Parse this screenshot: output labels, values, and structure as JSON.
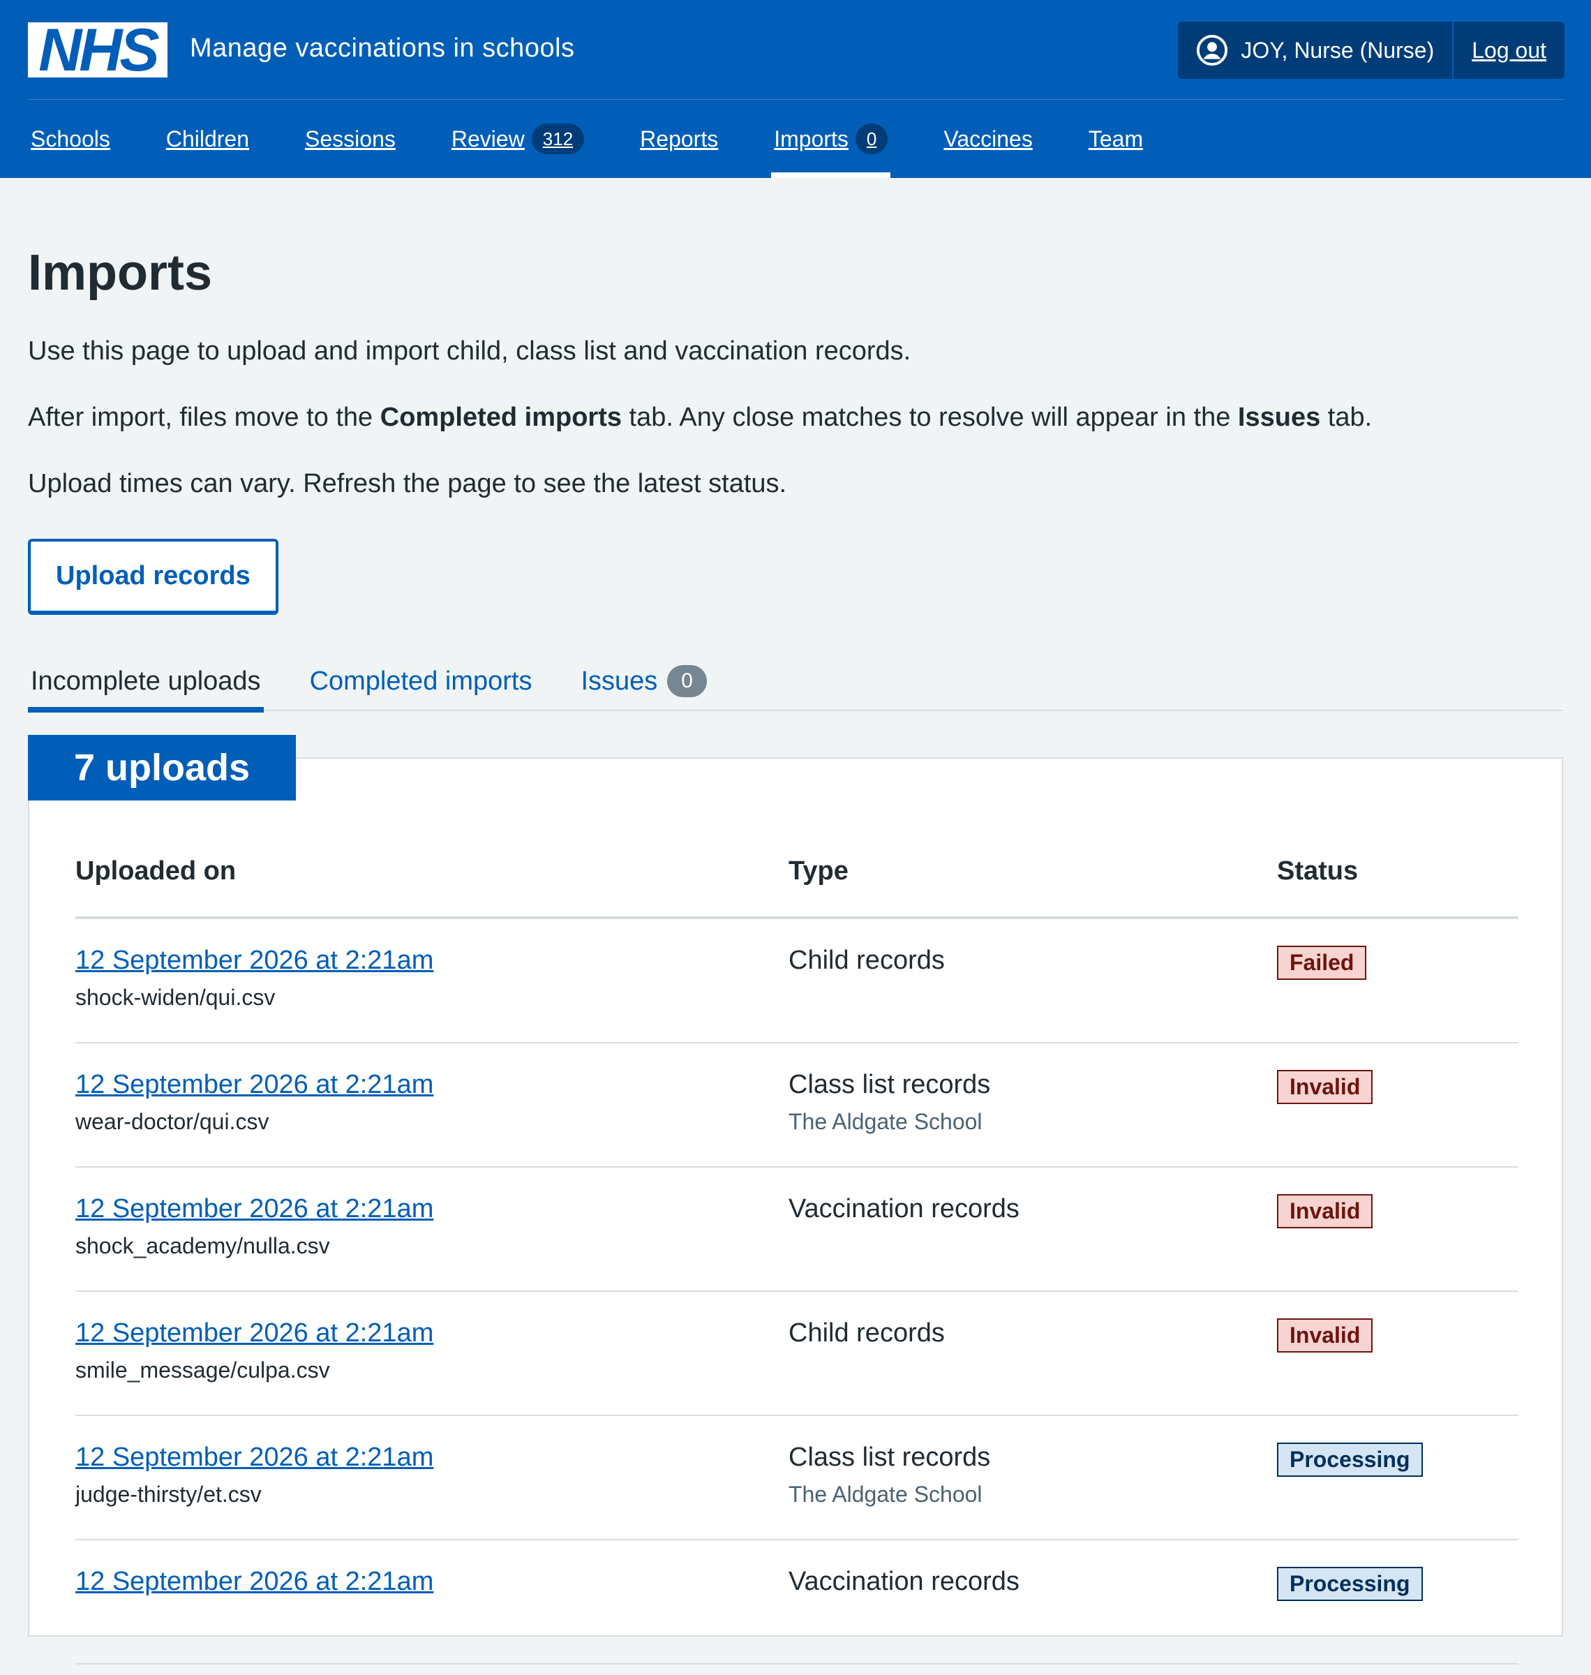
{
  "header": {
    "logo": "NHS",
    "service_name": "Manage vaccinations in schools",
    "user": "JOY, Nurse (Nurse)",
    "logout": "Log out",
    "nav": [
      {
        "label": "Schools"
      },
      {
        "label": "Children"
      },
      {
        "label": "Sessions"
      },
      {
        "label": "Review",
        "count": "312"
      },
      {
        "label": "Reports"
      },
      {
        "label": "Imports",
        "count": "0",
        "active": true
      },
      {
        "label": "Vaccines"
      },
      {
        "label": "Team"
      }
    ]
  },
  "page": {
    "title": "Imports",
    "intro1": "Use this page to upload and import child, class list and vaccination records.",
    "intro2_a": "After import, files move to the ",
    "intro2_b": "Completed imports",
    "intro2_c": " tab. Any close matches to resolve will appear in the ",
    "intro2_d": "Issues",
    "intro2_e": " tab.",
    "intro3": "Upload times can vary. Refresh the page to see the latest status.",
    "upload_button": "Upload records"
  },
  "tabs": [
    {
      "label": "Incomplete uploads",
      "active": true
    },
    {
      "label": "Completed imports"
    },
    {
      "label": "Issues",
      "count": "0"
    }
  ],
  "uploads": {
    "heading": "7 uploads",
    "columns": [
      "Uploaded on",
      "Type",
      "Status"
    ],
    "rows": [
      {
        "date": "12 September 2026 at 2:21am",
        "file": "shock-widen/qui.csv",
        "type": "Child records",
        "school": "",
        "status": "Failed"
      },
      {
        "date": "12 September 2026 at 2:21am",
        "file": "wear-doctor/qui.csv",
        "type": "Class list records",
        "school": "The Aldgate School",
        "status": "Invalid"
      },
      {
        "date": "12 September 2026 at 2:21am",
        "file": "shock_academy/nulla.csv",
        "type": "Vaccination records",
        "school": "",
        "status": "Invalid"
      },
      {
        "date": "12 September 2026 at 2:21am",
        "file": "smile_message/culpa.csv",
        "type": "Child records",
        "school": "",
        "status": "Invalid"
      },
      {
        "date": "12 September 2026 at 2:21am",
        "file": "judge-thirsty/et.csv",
        "type": "Class list records",
        "school": "The Aldgate School",
        "status": "Processing"
      },
      {
        "date": "12 September 2026 at 2:21am",
        "file": "",
        "type": "Vaccination records",
        "school": "",
        "status": "Processing"
      }
    ]
  },
  "colors": {
    "brand": "#005eb8",
    "dark_blue": "#003d78",
    "failed": "#f7d4d1",
    "processing": "#d6e5f3"
  }
}
